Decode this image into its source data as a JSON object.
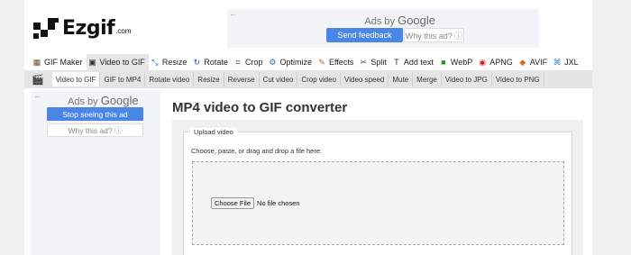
{
  "logo": {
    "text": "Ezgif",
    "suffix": ".com"
  },
  "top_ad": {
    "back_arrow": "←",
    "ads_by": "Ads by",
    "google": "Google",
    "send_feedback": "Send feedback",
    "why_this_ad": "Why this ad? ⓘ"
  },
  "mainnav": {
    "items": [
      {
        "label": "GIF Maker",
        "icon": "gif-maker-icon",
        "glyph": "▦",
        "color": "#6b4b2a"
      },
      {
        "label": "Video to GIF",
        "icon": "video-icon",
        "glyph": "▣",
        "color": "#333333"
      },
      {
        "label": "Resize",
        "icon": "resize-icon",
        "glyph": "⤡",
        "color": "#1e5aa8"
      },
      {
        "label": "Rotate",
        "icon": "rotate-icon",
        "glyph": "↻",
        "color": "#1e5aa8"
      },
      {
        "label": "Crop",
        "icon": "crop-icon",
        "glyph": "⌗",
        "color": "#333333"
      },
      {
        "label": "Optimize",
        "icon": "optimize-icon",
        "glyph": "⚙",
        "color": "#2a6ebb"
      },
      {
        "label": "Effects",
        "icon": "effects-icon",
        "glyph": "✎",
        "color": "#b07020"
      },
      {
        "label": "Split",
        "icon": "split-icon",
        "glyph": "✂",
        "color": "#444444"
      },
      {
        "label": "Add text",
        "icon": "add-text-icon",
        "glyph": "T",
        "color": "#333333"
      },
      {
        "label": "WebP",
        "icon": "webp-icon",
        "glyph": "■",
        "color": "#2e8b2e"
      },
      {
        "label": "APNG",
        "icon": "apng-icon",
        "glyph": "◉",
        "color": "#cc2222"
      },
      {
        "label": "AVIF",
        "icon": "avif-icon",
        "glyph": "◆",
        "color": "#d2691e"
      },
      {
        "label": "JXL",
        "icon": "jxl-icon",
        "glyph": "⌘",
        "color": "#2b86d8"
      }
    ]
  },
  "subnav": {
    "film_glyph": "🎬",
    "items": [
      {
        "label": "Video to GIF"
      },
      {
        "label": "GIF to MP4"
      },
      {
        "label": "Rotate video"
      },
      {
        "label": "Resize"
      },
      {
        "label": "Reverse"
      },
      {
        "label": "Cut video"
      },
      {
        "label": "Crop video"
      },
      {
        "label": "Video speed"
      },
      {
        "label": "Mute"
      },
      {
        "label": "Merge"
      },
      {
        "label": "Video to JPG"
      },
      {
        "label": "Video to PNG"
      }
    ]
  },
  "side_ad": {
    "back_arrow": "←",
    "ads_by": "Ads by",
    "google": "Google",
    "stop_seeing": "Stop seeing this ad",
    "why_this_ad": "Why this ad? ⓘ"
  },
  "main": {
    "title": "MP4 video to GIF converter",
    "legend": "Upload video",
    "prompt": "Choose, paste, or drag and drop a file here:",
    "choose_file": "Choose File",
    "no_file": "No file chosen"
  }
}
